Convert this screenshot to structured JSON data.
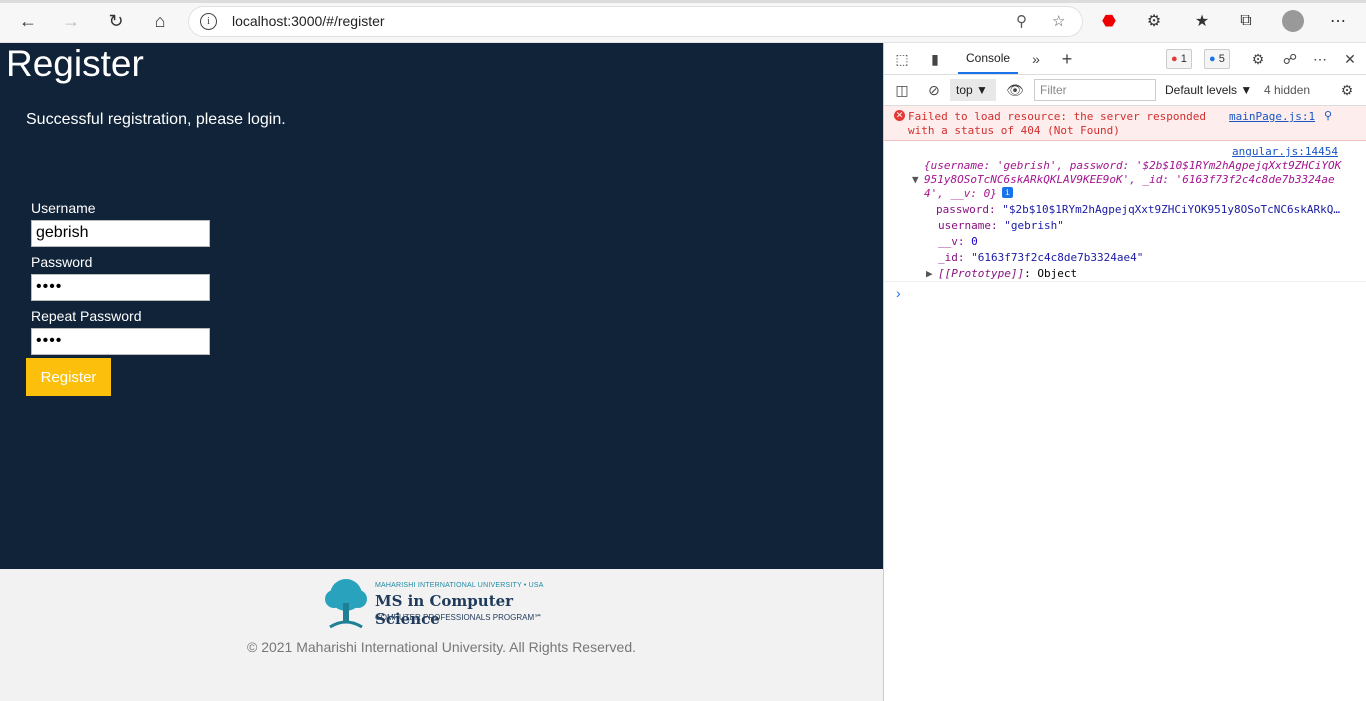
{
  "browser": {
    "url": "localhost:3000/#/register"
  },
  "page": {
    "title": "Register",
    "message": "Successful registration, please login.",
    "username_label": "Username",
    "username_value": "gebrish",
    "password_label": "Password",
    "password_value": "••••",
    "repeat_label": "Repeat Password",
    "repeat_value": "••••",
    "submit_label": "Register"
  },
  "footer": {
    "logo_small": "MAHARISHI INTERNATIONAL UNIVERSITY • USA",
    "logo_big": "MS in Computer Science",
    "logo_sub": "COMPUTER PROFESSIONALS PROGRAM℠",
    "copyright": "© 2021 Maharishi International University. All Rights Reserved."
  },
  "devtools": {
    "tab": "Console",
    "error_count": "1",
    "info_count": "5",
    "context": "top",
    "filter_placeholder": "Filter",
    "levels": "Default levels",
    "hidden": "4 hidden",
    "error_text": "Failed to load resource: the server responded with a status of 404 (Not Found)",
    "error_source": "mainPage.js:1",
    "log_source": "angular.js:14454",
    "log_summary_1": "{username: 'gebrish', password: '$2b$10$1RYm2hAgpejqXxt9ZHCiYOK",
    "log_summary_2": "951y8OSoTcNC6skARkQKLAV9KEE9oK', _id: '6163f73f2c4c8de7b3324ae",
    "log_summary_3": "4', __v: 0}",
    "password_key": "password:",
    "password_val": "\"$2b$10$1RYm2hAgpejqXxt9ZHCiYOK951y8OSoTcNC6skARkQ…",
    "username_key": "username:",
    "username_val": "\"gebrish\"",
    "v_key": "__v:",
    "v_val": "0",
    "id_key": "_id:",
    "id_val": "\"6163f73f2c4c8de7b3324ae4\"",
    "proto_key": "[[Prototype]]",
    "proto_val": ": Object"
  }
}
